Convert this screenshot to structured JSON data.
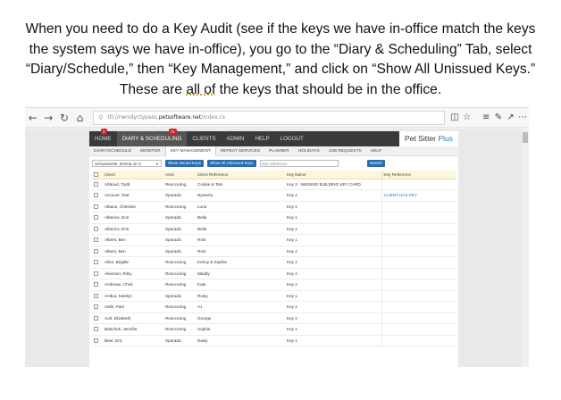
{
  "caption": {
    "part1": "When you need to do a Key Audit (see if the keys we have in-office match the keys the system says we have in-office), you go to the “Diary & Scheduling” Tab, select “Diary/Schedule,” then “Key Management,” and click on “Show All Unissued Keys.” These are ",
    "underlined": "all of",
    "part2": " the keys that should be in the office."
  },
  "browser": {
    "url_prefix": "tlt://rwnidyctypass.",
    "url_domain": "petsoftware.net",
    "url_path": "/index.cs"
  },
  "app": {
    "brand_name": "Pet Sitter",
    "brand_plus": "Plus",
    "main_tabs": [
      {
        "label": "HOME",
        "badge": "2"
      },
      {
        "label": "DIARY & SCHEDULING",
        "badge": "71"
      },
      {
        "label": "CLIENTS"
      },
      {
        "label": "ADMIN"
      },
      {
        "label": "HELP"
      },
      {
        "label": "LOGOUT"
      }
    ],
    "sub_tabs": [
      "DIARY/SCHEDULE",
      "MONITOR",
      "KEY MANAGEMENT",
      "REPEAT SERVICES",
      "PLANNER",
      "HOLIDAYS",
      "JOB REQUESTS",
      "HELP"
    ],
    "filters": {
      "sitter_value": "Schumacher, Emma Jo S",
      "btn_issued": "Show Issued Keys",
      "btn_unissued": "Show All Unissued Keys",
      "search_placeholder": "key reference...",
      "btn_search": "Search"
    },
    "table": {
      "headers": [
        "Client",
        "Area",
        "Client Reference",
        "Key Name",
        "Key Reference"
      ],
      "rows": [
        [
          "Abboud, Todd",
          "Reoccuring",
          "Cookie & Tam",
          "Key 2 - MISSING BUILDING KEY CARD",
          ""
        ],
        [
          "Account, Test",
          "Sporadic",
          "Nymeria",
          "Key 2",
          "CLIENT HAS KEY"
        ],
        [
          "Albano, Christine",
          "Reoccuring",
          "Luna",
          "Key 2",
          ""
        ],
        [
          "Alberico, Erin",
          "Sporadic",
          "Bella",
          "Key 1",
          ""
        ],
        [
          "Alberico, Erin",
          "Sporadic",
          "Bella",
          "Key 2",
          ""
        ],
        [
          "Albers, Ben",
          "Sporadic",
          "Rolo",
          "Key 1",
          ""
        ],
        [
          "Albers, Ben",
          "Sporadic",
          "Rolo",
          "Key 2",
          ""
        ],
        [
          "Allen, Brigitte",
          "Reoccuring",
          "Kenny & Sophie",
          "Key 2",
          ""
        ],
        [
          "Alverson, Riley",
          "Reoccuring",
          "Maddy",
          "Key 2",
          ""
        ],
        [
          "Ambrose, Chris",
          "Reoccuring",
          "Kate",
          "Key 2",
          ""
        ],
        [
          "Antkut, Katelyn",
          "Sporadic",
          "Rusty",
          "Key 1",
          ""
        ],
        [
          "Astle, Pam",
          "Reoccuring",
          "AJ",
          "Key 2",
          ""
        ],
        [
          "Ault, Elizabeth",
          "Reoccuring",
          "George",
          "Key 2",
          ""
        ],
        [
          "Babchuk, Jennifer",
          "Reoccuring",
          "Sophie",
          "Key 1",
          ""
        ],
        [
          "Beer, Eric",
          "Sporadic",
          "Daisy",
          "Key 1",
          ""
        ]
      ]
    }
  },
  "icons": [
    "back-icon",
    "forward-icon",
    "refresh-icon",
    "home-icon",
    "lock-icon",
    "reader-icon",
    "favorite-icon",
    "favorites-bar-icon",
    "notes-icon",
    "share-icon",
    "more-icon"
  ]
}
